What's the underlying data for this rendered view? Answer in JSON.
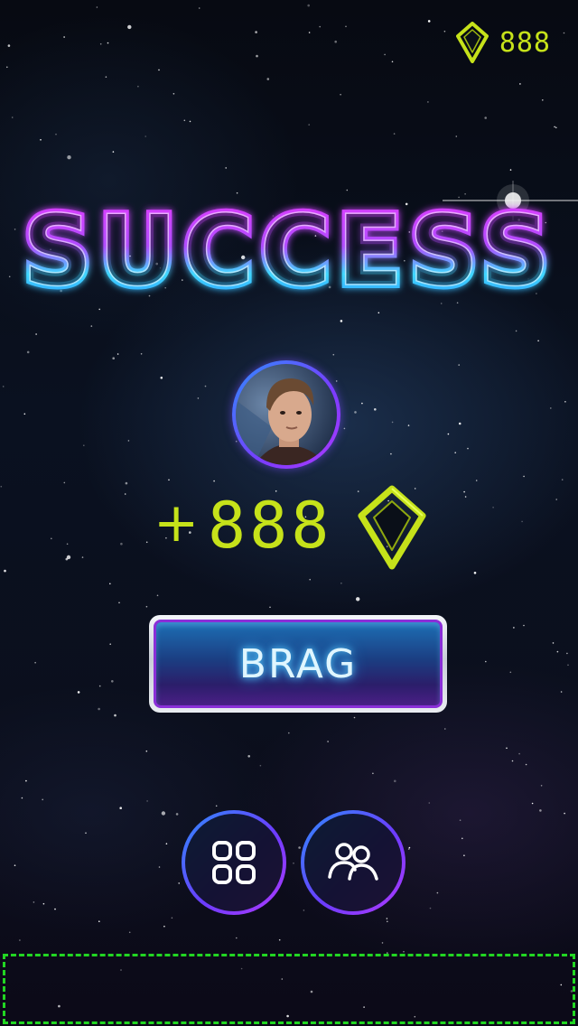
{
  "header": {
    "gem_count": "888",
    "gem_icon": "gem-icon"
  },
  "title": {
    "text": "SUCCESS"
  },
  "player": {
    "avatar_icon": "player-avatar"
  },
  "reward": {
    "plus": "+",
    "amount": "888",
    "gem_icon": "gem-icon"
  },
  "buttons": {
    "brag_label": "BRAG",
    "menu_icon": "grid-menu-icon",
    "friends_icon": "friends-icon"
  },
  "colors": {
    "gem": "#c6e21a",
    "title_top": "#e23cff",
    "title_bottom": "#34e6ff",
    "ring": "#7a3cff",
    "ad_border": "#22d622"
  }
}
